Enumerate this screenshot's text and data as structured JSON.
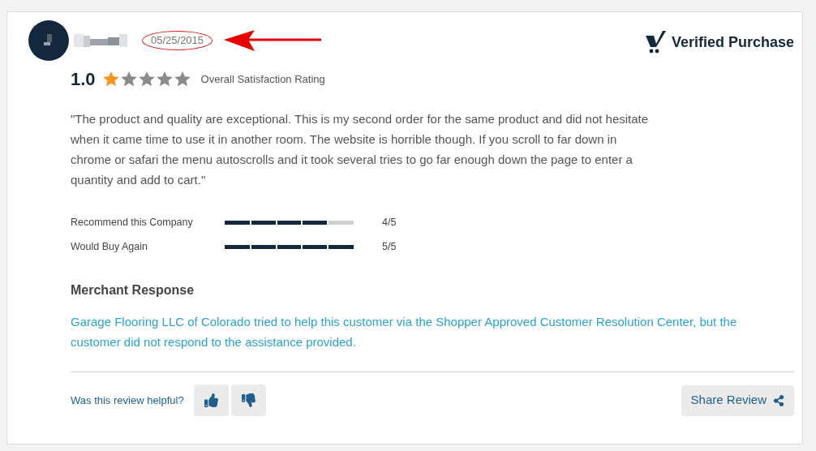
{
  "review": {
    "date": "05/25/2015",
    "badge": "Verified Purchase",
    "score": "1.0",
    "stars": 1,
    "rating_label": "Overall Satisfaction Rating",
    "text": "\"The product and quality are exceptional. This is my second order for the same product and did not hesitate when it came time to use it in another room. The website is horrible though. If you scroll to far down in chrome or safari the menu autoscrolls and it took several tries to go far enough down the page to enter a quantity and add to cart.\"",
    "metrics": [
      {
        "label": "Recommend this Company",
        "level": 0.8,
        "reading": "4/5"
      },
      {
        "label": "Would Buy Again",
        "level": 1.0,
        "reading": "5/5"
      }
    ],
    "response_title": "Merchant Response",
    "response_text": "Garage Flooring LLC of Colorado tried to help this customer via the Shopper Approved Customer Resolution Center, but the customer did not respond to the assistance provided.",
    "helpful_prompt": "Was this review helpful?",
    "share_label": "Share Review"
  }
}
